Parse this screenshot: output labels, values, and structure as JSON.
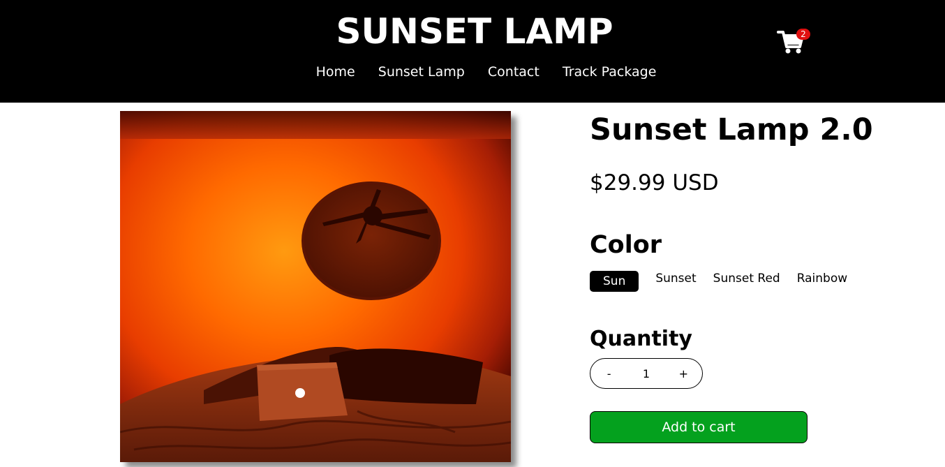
{
  "header": {
    "site_title": "SUNSET LAMP",
    "nav": [
      "Home",
      "Sunset Lamp",
      "Contact",
      "Track Package"
    ],
    "cart_count": "2"
  },
  "product": {
    "title": "Sunset Lamp 2.0",
    "price": "$29.99 USD",
    "image_description": "Orange sunset lamp glow on ceiling with fan, laptop on bed",
    "color_heading": "Color",
    "colors": [
      "Sun",
      "Sunset",
      "Sunset Red",
      "Rainbow"
    ],
    "selected_color": "Sun",
    "quantity_heading": "Quantity",
    "quantity": {
      "minus_label": "-",
      "value": "1",
      "plus_label": "+"
    },
    "add_to_cart_label": "Add to cart"
  },
  "colors": {
    "header_bg": "#000000",
    "badge": "#e01010",
    "add_to_cart": "#04a11e"
  }
}
